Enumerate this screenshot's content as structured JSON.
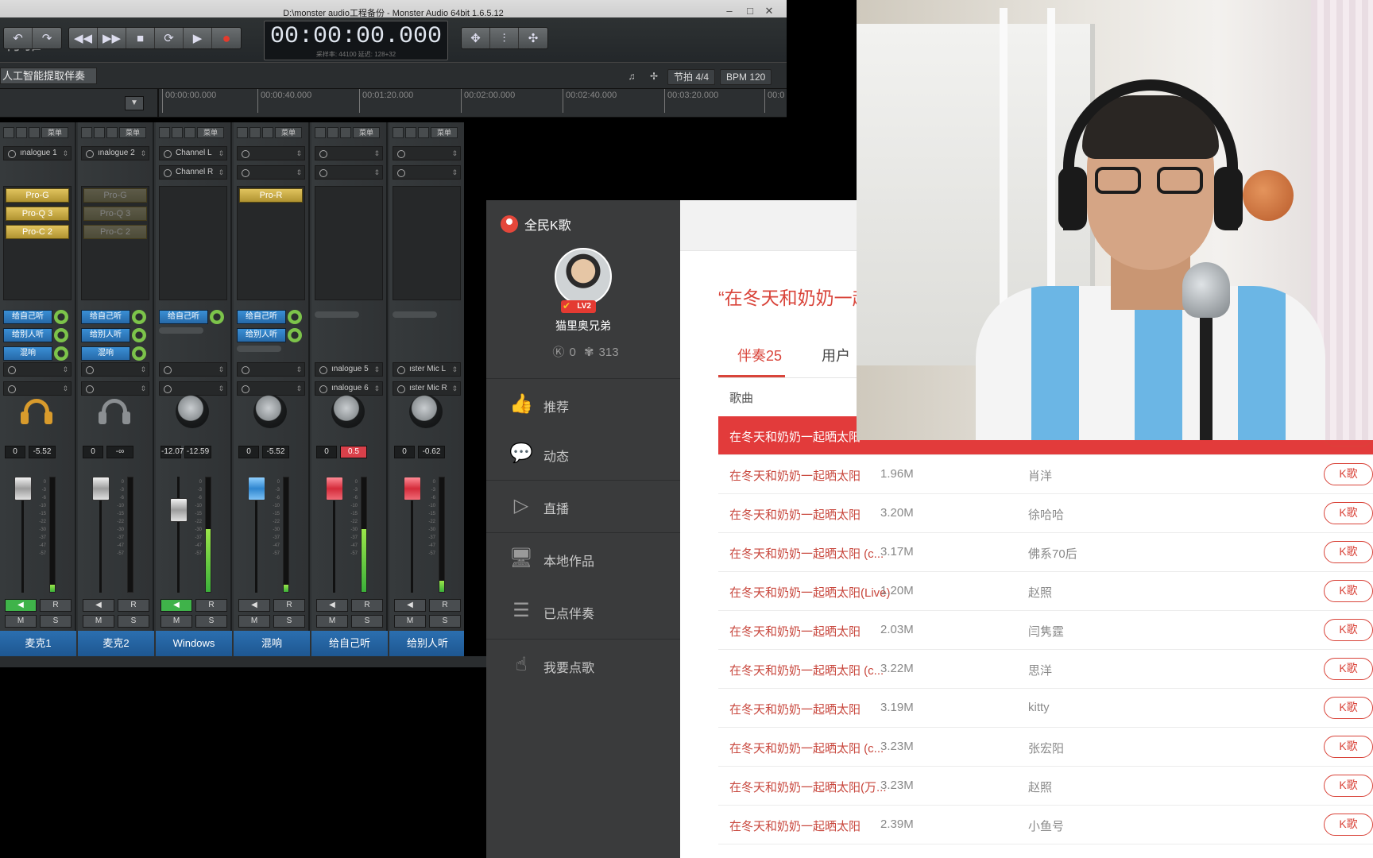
{
  "monster": {
    "title": "D:\\monster audio工程备份 - Monster Audio 64bit 1.6.5.12",
    "watermark": "有雅",
    "timecode": "00:00:00.000",
    "timecode_sub": "采样率: 44100   延迟: 128+32",
    "project_label": "人工智能提取伴奏",
    "beat": "节拍 4/4",
    "bpm": "BPM 120",
    "ruler": [
      "00:00:00.000",
      "00:00:40.000",
      "00:01:20.000",
      "00:02:00.000",
      "00:02:40.000",
      "00:03:20.000",
      "00:0"
    ],
    "strip_menu": "菜单",
    "strips": [
      {
        "name": "麦克1",
        "in1": "ınalogue 1",
        "in2": "",
        "plugins": [
          "Pro-G",
          "Pro-Q 3",
          "Pro-C 2"
        ],
        "sends": [
          "给自己听",
          "给别人听",
          "混响"
        ],
        "out1": "",
        "out2": "",
        "val1": "0",
        "val2": "-5.52"
      },
      {
        "name": "麦克2",
        "in1": "ınalogue 2",
        "in2": "",
        "plugins": [
          "Pro-G",
          "Pro-Q 3",
          "Pro-C 2"
        ],
        "sends": [
          "给自己听",
          "给别人听",
          "混响"
        ],
        "out1": "",
        "out2": "",
        "val1": "0",
        "val2": "-∞"
      },
      {
        "name": "Windows",
        "in1": "Channel L",
        "in2": "Channel R",
        "plugins": [],
        "sends": [
          "给自己听"
        ],
        "out1": "",
        "out2": "",
        "val1": "-12.07",
        "val2": "-12.59"
      },
      {
        "name": "混响",
        "in1": "",
        "in2": "",
        "plugins": [
          "Pro-R"
        ],
        "sends": [
          "给自己听",
          "给别人听"
        ],
        "out1": "",
        "out2": "",
        "val1": "0",
        "val2": "-5.52"
      },
      {
        "name": "给自己听",
        "in1": "",
        "in2": "",
        "plugins": [],
        "sends": [],
        "out1": "ınalogue 5",
        "out2": "ınalogue 6",
        "val1": "0",
        "val2": "0.5"
      },
      {
        "name": "给别人听",
        "in1": "",
        "in2": "",
        "plugins": [],
        "sends": [],
        "out1": "ıster Mic L",
        "out2": "ıster Mic R",
        "val1": "0",
        "val2": "-0.62"
      }
    ],
    "scale": [
      "0",
      "-3",
      "-6",
      "-10",
      "-15",
      "-22",
      "-30",
      "-37",
      "-47",
      "-57"
    ],
    "m_label": "M",
    "s_label": "S",
    "r_label": "R"
  },
  "kg": {
    "brand": "全民K歌",
    "level": "LV2",
    "username": "猫里奥兄弟",
    "stat_k": "0",
    "stat_f": "313",
    "nav": [
      "推荐",
      "动态",
      "直播",
      "本地作品",
      "已点伴奏",
      "我要点歌"
    ],
    "search_title": "“在冬天和奶奶一起",
    "tabs": [
      "伴奏25",
      "用户"
    ],
    "col_song": "歌曲",
    "k_btn": "K歌",
    "rows": [
      {
        "song": "在冬天和奶奶一起晒太阳",
        "size": "",
        "singer": ""
      },
      {
        "song": "在冬天和奶奶一起晒太阳",
        "size": "1.96M",
        "singer": "肖洋"
      },
      {
        "song": "在冬天和奶奶一起晒太阳",
        "size": "3.20M",
        "singer": "徐哈哈"
      },
      {
        "song": "在冬天和奶奶一起晒太阳 (c...",
        "size": "3.17M",
        "singer": "佛系70后"
      },
      {
        "song": "在冬天和奶奶一起晒太阳(Live)",
        "size": "1.20M",
        "singer": "赵照"
      },
      {
        "song": "在冬天和奶奶一起晒太阳",
        "size": "2.03M",
        "singer": "闫隽霆"
      },
      {
        "song": "在冬天和奶奶一起晒太阳 (c...",
        "size": "3.22M",
        "singer": "思洋"
      },
      {
        "song": "在冬天和奶奶一起晒太阳",
        "size": "3.19M",
        "singer": "kitty"
      },
      {
        "song": "在冬天和奶奶一起晒太阳 (c...",
        "size": "3.23M",
        "singer": "张宏阳"
      },
      {
        "song": "在冬天和奶奶一起晒太阳(万...",
        "size": "3.23M",
        "singer": "赵照"
      },
      {
        "song": "在冬天和奶奶一起晒太阳",
        "size": "2.39M",
        "singer": "小鱼号"
      }
    ]
  }
}
